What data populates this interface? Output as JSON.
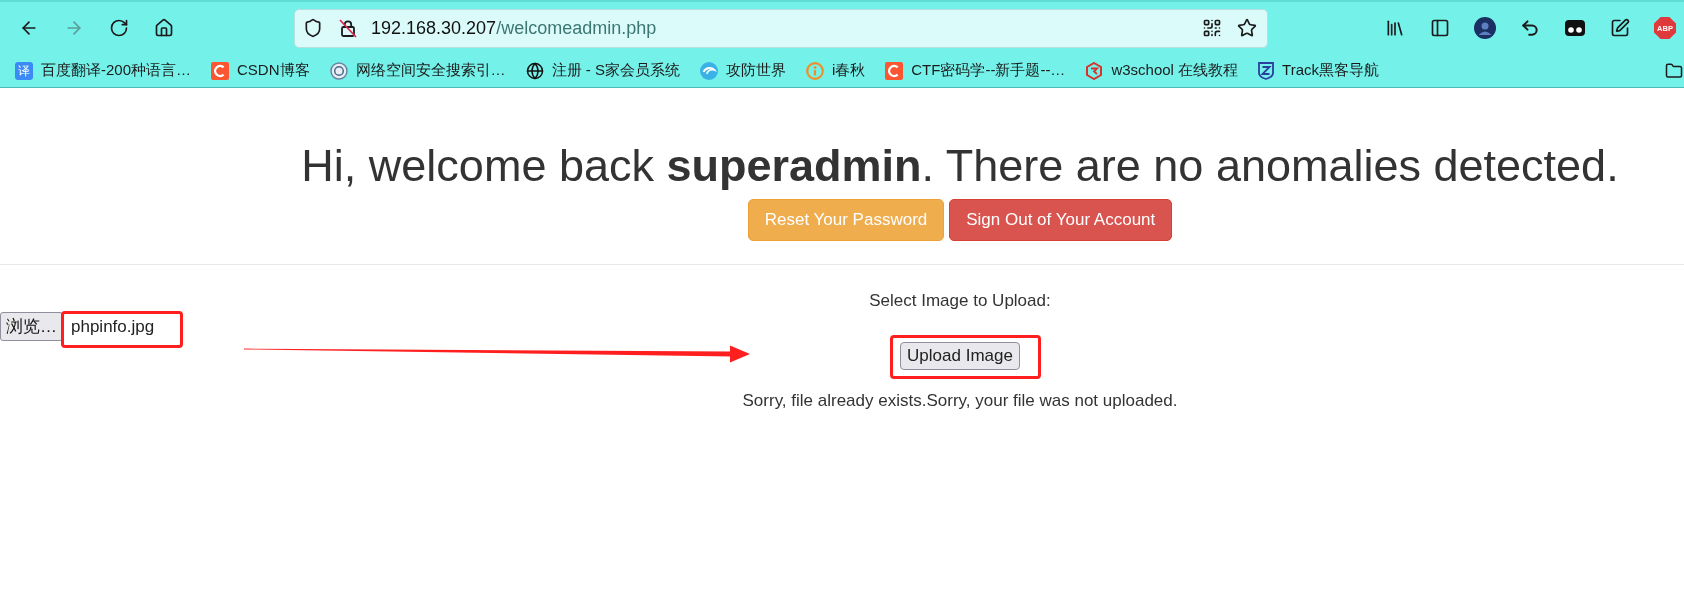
{
  "toolbar": {
    "nav_buttons": [
      {
        "kind": "back",
        "disabled": false
      },
      {
        "kind": "forward",
        "disabled": true
      },
      {
        "kind": "reload",
        "disabled": false
      },
      {
        "kind": "home",
        "disabled": false
      }
    ],
    "address_bar": {
      "host": "192.168.30.207",
      "path": "/welcomeadmin.php"
    },
    "extensions": [
      {
        "kind": "library"
      },
      {
        "kind": "sidebar"
      },
      {
        "kind": "avatar"
      },
      {
        "kind": "undo"
      },
      {
        "kind": "mask"
      },
      {
        "kind": "pen"
      },
      {
        "kind": "adblock",
        "label": "ABP"
      }
    ]
  },
  "bookmarks": [
    {
      "kind": "translate",
      "icon_text": "译",
      "label": "百度翻译-200种语言…"
    },
    {
      "kind": "c-tile",
      "label": "CSDN博客"
    },
    {
      "kind": "circle",
      "label": "网络空间安全搜索引…"
    },
    {
      "kind": "globe",
      "label": "注册 - S家会员系统"
    },
    {
      "kind": "swirl",
      "label": "攻防世界"
    },
    {
      "kind": "ring",
      "label": "i春秋"
    },
    {
      "kind": "c-tile",
      "label": "CTF密码学--新手题--…"
    },
    {
      "kind": "hexagon",
      "label": "w3school 在线教程"
    },
    {
      "kind": "shield",
      "label": "Track黑客导航"
    }
  ],
  "page": {
    "heading": "Hi, welcome back **superadmin**. There are no anomalies detected.",
    "actions": [
      {
        "kind": "warning",
        "label": "Reset Your Password"
      },
      {
        "kind": "danger",
        "label": "Sign Out of Your Account"
      }
    ],
    "upload": {
      "label": "Select Image to Upload:",
      "browse_button": "浏览…",
      "file_name": "phpinfo.jpg",
      "submit": "Upload Image",
      "message": "Sorry, file already exists.Sorry, your file was not uploaded."
    }
  }
}
